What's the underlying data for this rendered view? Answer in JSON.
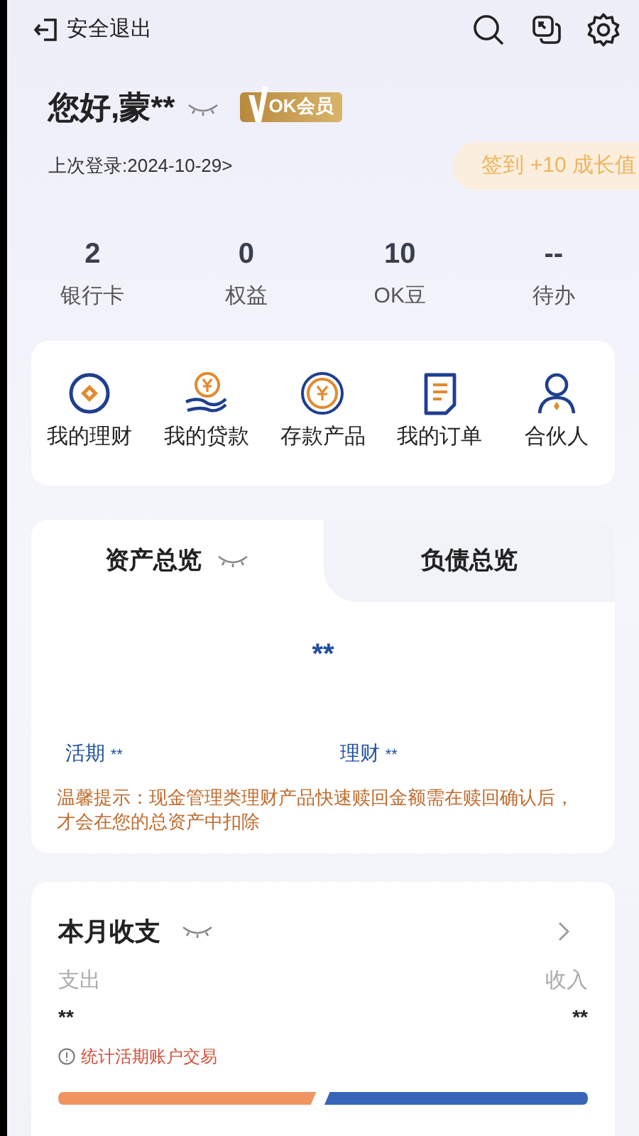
{
  "header": {
    "logout": "安全退出"
  },
  "greeting": {
    "text": "您好,蒙**",
    "badge": "OK会员",
    "last_login": "上次登录:2024-10-29>",
    "checkin": "签到 +10 成长值"
  },
  "stats": [
    {
      "value": "2",
      "label": "银行卡"
    },
    {
      "value": "0",
      "label": "权益"
    },
    {
      "value": "10",
      "label": "OK豆"
    },
    {
      "value": "--",
      "label": "待办"
    }
  ],
  "shortcuts": [
    {
      "kind": "wealth",
      "label": "我的理财"
    },
    {
      "kind": "loan",
      "label": "我的贷款"
    },
    {
      "kind": "deposit",
      "label": "存款产品"
    },
    {
      "kind": "order",
      "label": "我的订单"
    },
    {
      "kind": "partner",
      "label": "合伙人"
    }
  ],
  "overview": {
    "tabs": [
      {
        "label": "资产总览",
        "selected": true
      },
      {
        "label": "负债总览",
        "selected": false
      }
    ],
    "total": "**",
    "items": [
      {
        "label": "活期",
        "value": "**"
      },
      {
        "label": "理财",
        "value": "**"
      }
    ],
    "notice": "温馨提示：现金管理类理财产品快速赎回金额需在赎回确认后，才会在您的总资产中扣除"
  },
  "monthly": {
    "title": "本月收支",
    "expense_label": "支出",
    "income_label": "收入",
    "expense": "**",
    "income": "**",
    "note": "统计活期账户交易"
  }
}
